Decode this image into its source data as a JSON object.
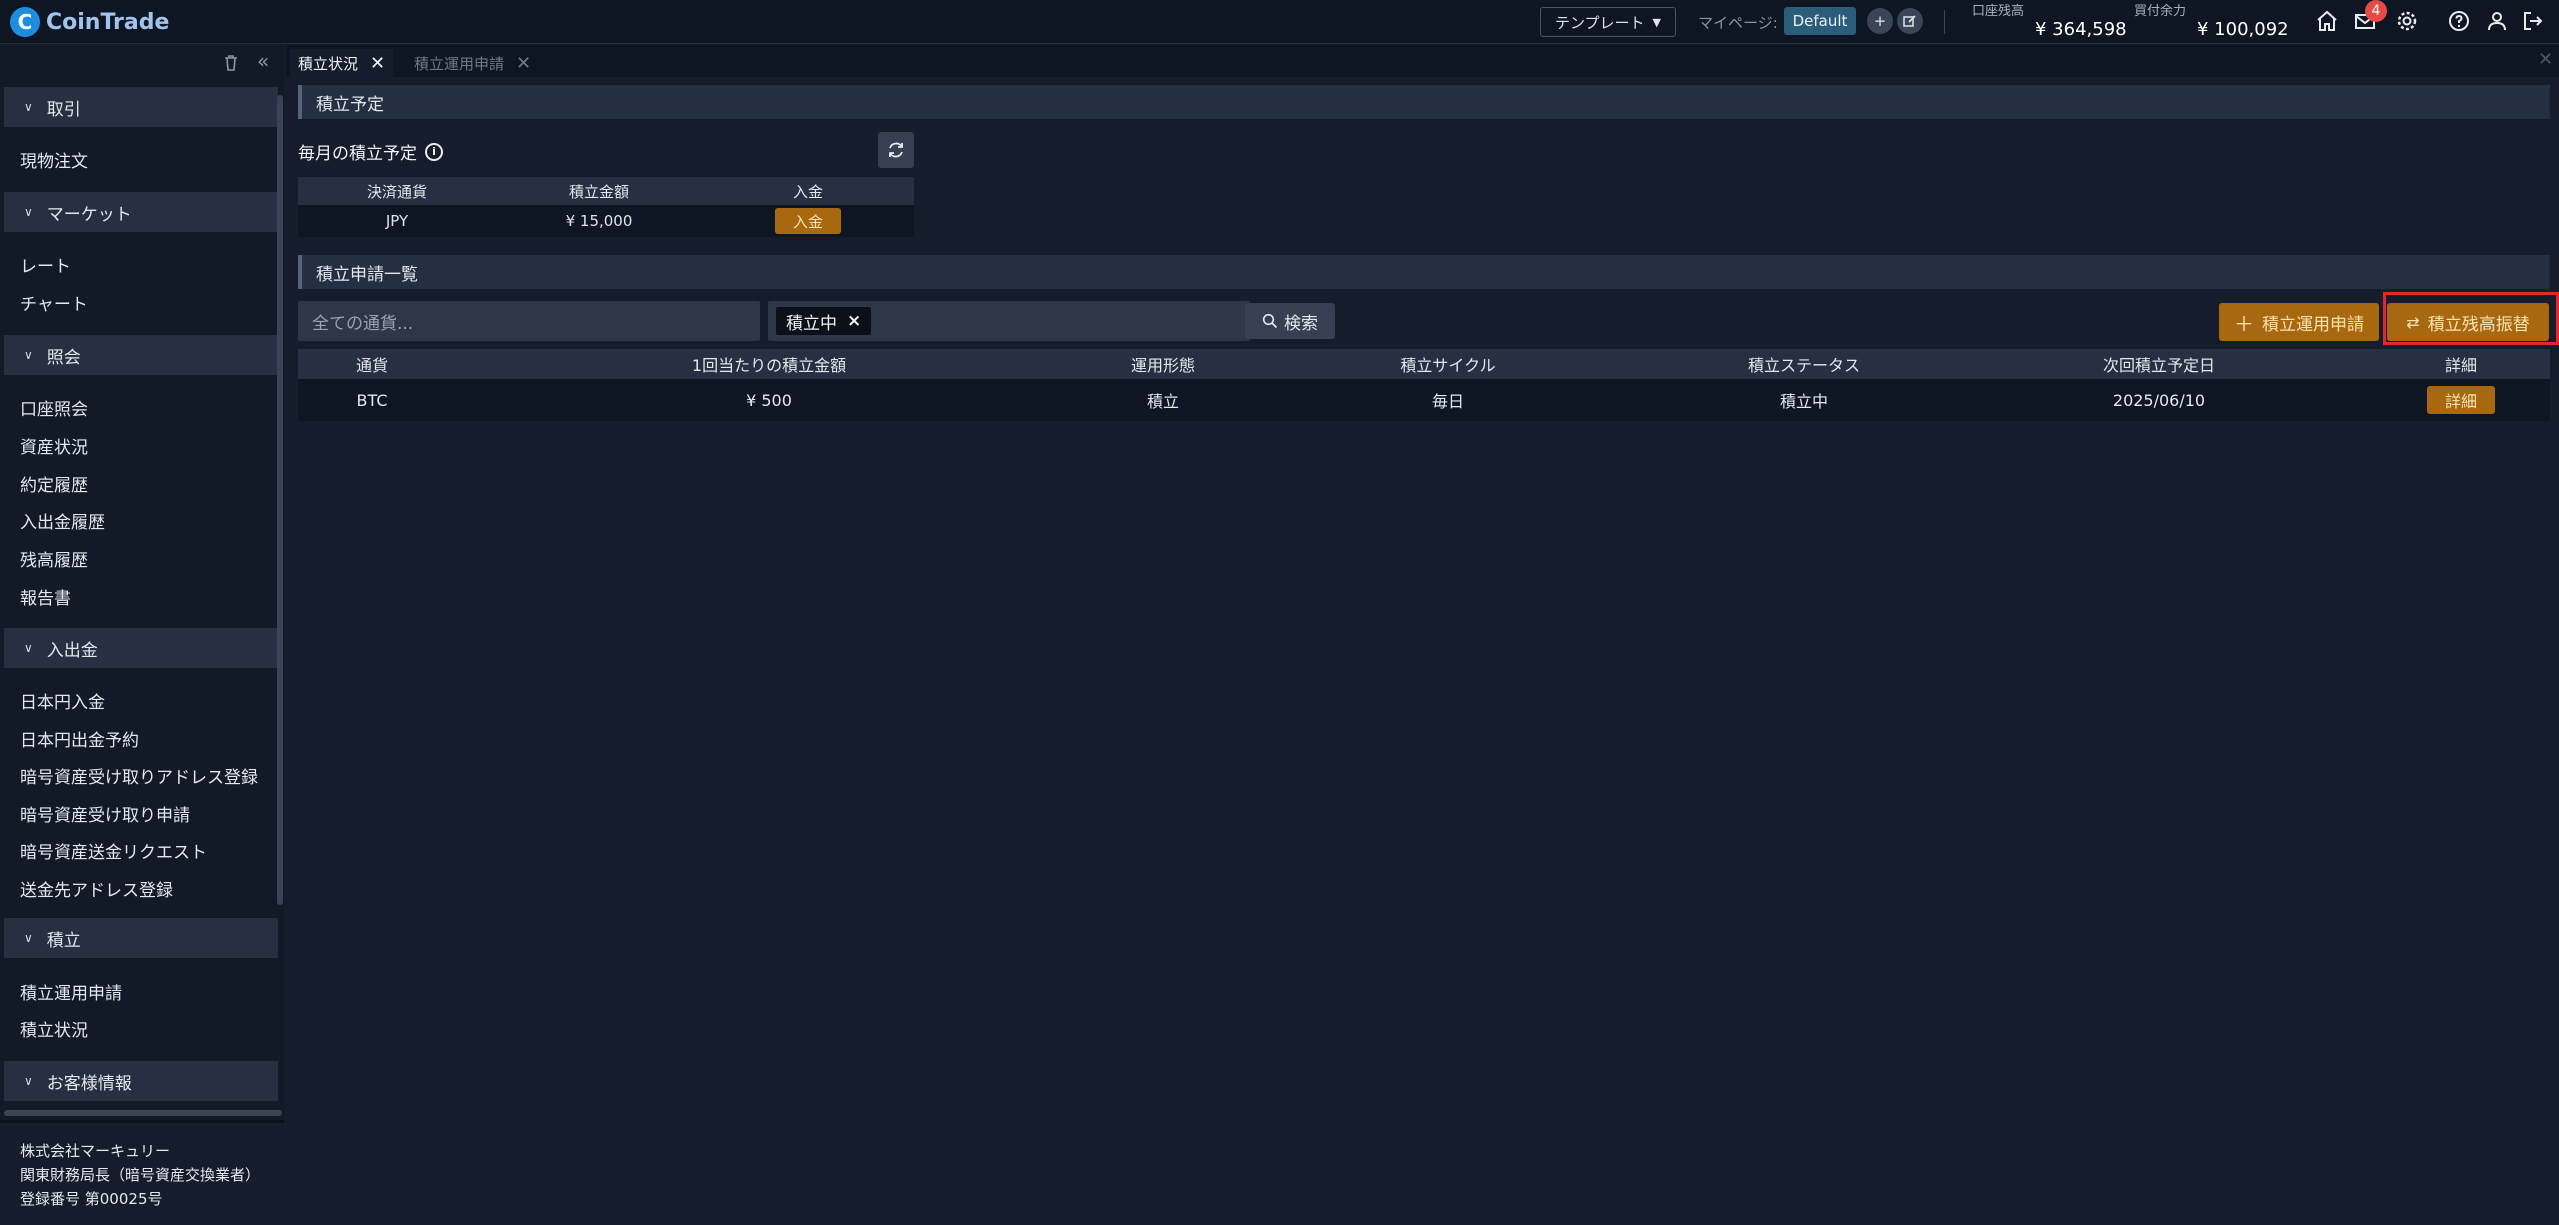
{
  "app": {
    "logo_letter": "C",
    "name": "CoinTrade"
  },
  "header": {
    "template_label": "テンプレート",
    "mypage_label": "マイページ:",
    "default_badge": "Default",
    "plus_label": "+",
    "balance_label": "口座残高",
    "balance_value": "¥ 364,598",
    "buying_power_label": "買付余力",
    "buying_power_value": "¥ 100,092",
    "notification_count": "4",
    "icons": [
      "home-icon",
      "mail-icon",
      "gear-icon",
      "help-icon",
      "user-icon",
      "logout-icon"
    ]
  },
  "sidebar": {
    "collapse_label": "«",
    "sections": [
      {
        "title": "取引",
        "items": [
          "現物注文"
        ]
      },
      {
        "title": "マーケット",
        "items": [
          "レート",
          "チャート"
        ]
      },
      {
        "title": "照会",
        "items": [
          "口座照会",
          "資産状況",
          "約定履歴",
          "入出金履歴",
          "残高履歴",
          "報告書"
        ]
      },
      {
        "title": "入出金",
        "items": [
          "日本円入金",
          "日本円出金予約",
          "暗号資産受け取りアドレス登録",
          "暗号資産受け取り申請",
          "暗号資産送金リクエスト",
          "送金先アドレス登録"
        ]
      },
      {
        "title": "積立",
        "items": [
          "積立運用申請",
          "積立状況"
        ]
      },
      {
        "title": "お客様情報",
        "items": []
      }
    ],
    "footer": [
      "株式会社マーキュリー",
      "関東財務局長（暗号資産交換業者）",
      "登録番号 第00025号"
    ]
  },
  "tabs": [
    {
      "label": "積立状況",
      "close": "✕"
    },
    {
      "label": "積立運用申請",
      "close": "✕"
    }
  ],
  "plan": {
    "section_title": "積立予定",
    "monthly_label": "毎月の積立予定",
    "info": "i",
    "columns": [
      "決済通貨",
      "積立金額",
      "入金"
    ],
    "row": {
      "currency": "JPY",
      "amount": "¥ 15,000",
      "deposit_button": "入金"
    }
  },
  "list": {
    "section_title": "積立申請一覧",
    "filter_placeholder": "全ての通貨...",
    "status_tag": "積立中",
    "tag_remove": "×",
    "search_button": "検索",
    "apply_button": "積立運用申請",
    "transfer_button": "積立残高振替",
    "columns": [
      "通貨",
      "1回当たりの積立金額",
      "運用形態",
      "積立サイクル",
      "積立ステータス",
      "次回積立予定日",
      "詳細"
    ],
    "rows": [
      {
        "currency": "BTC",
        "amount": "¥ 500",
        "type": "積立",
        "cycle": "毎日",
        "status": "積立中",
        "next_date": "2025/06/10",
        "detail": "詳細"
      }
    ]
  },
  "colors": {
    "accent": "#a8680f",
    "highlight": "#e0292f",
    "badge": "#e74a45",
    "brand": "#1c8ee0"
  }
}
